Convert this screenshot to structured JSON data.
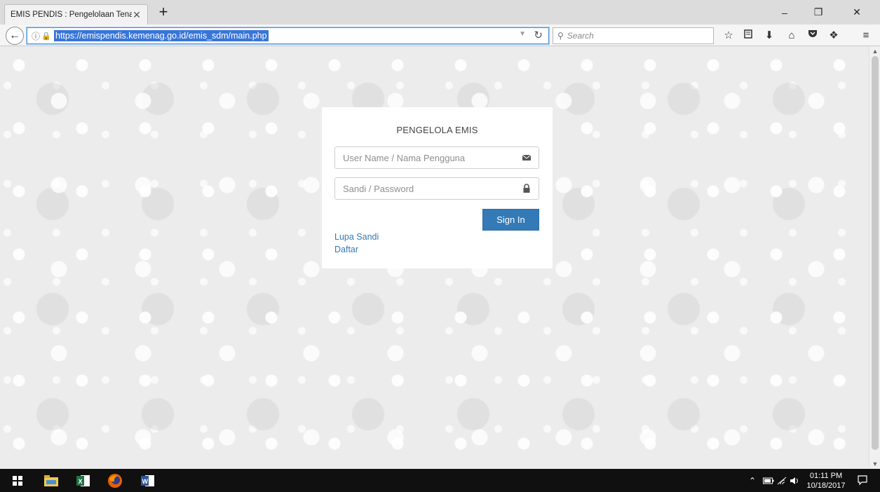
{
  "browser": {
    "tab_title": "EMIS PENDIS : Pengelolaan Tena",
    "tab_close": "✕",
    "new_tab": "+",
    "url": "https://emispendis.kemenag.go.id/emis_sdm/main.php",
    "search_placeholder": "Search",
    "window": {
      "minimize": "–",
      "restore": "❐",
      "close": "✕"
    }
  },
  "login": {
    "title": "PENGELOLA EMIS",
    "username_placeholder": "User Name / Nama Pengguna",
    "password_placeholder": "Sandi / Password",
    "signin_label": "Sign In",
    "forgot_label": "Lupa Sandi",
    "register_label": "Daftar"
  },
  "taskbar": {
    "time": "01:11 PM",
    "date": "10/18/2017"
  },
  "colors": {
    "primary_button": "#337ab7",
    "link": "#337ab7",
    "url_highlight": "#3875d7"
  },
  "icons": [
    "envelope-icon",
    "lock-icon",
    "star-icon",
    "reader-icon",
    "download-icon",
    "home-icon",
    "pocket-icon",
    "extension-icon",
    "menu-icon"
  ]
}
